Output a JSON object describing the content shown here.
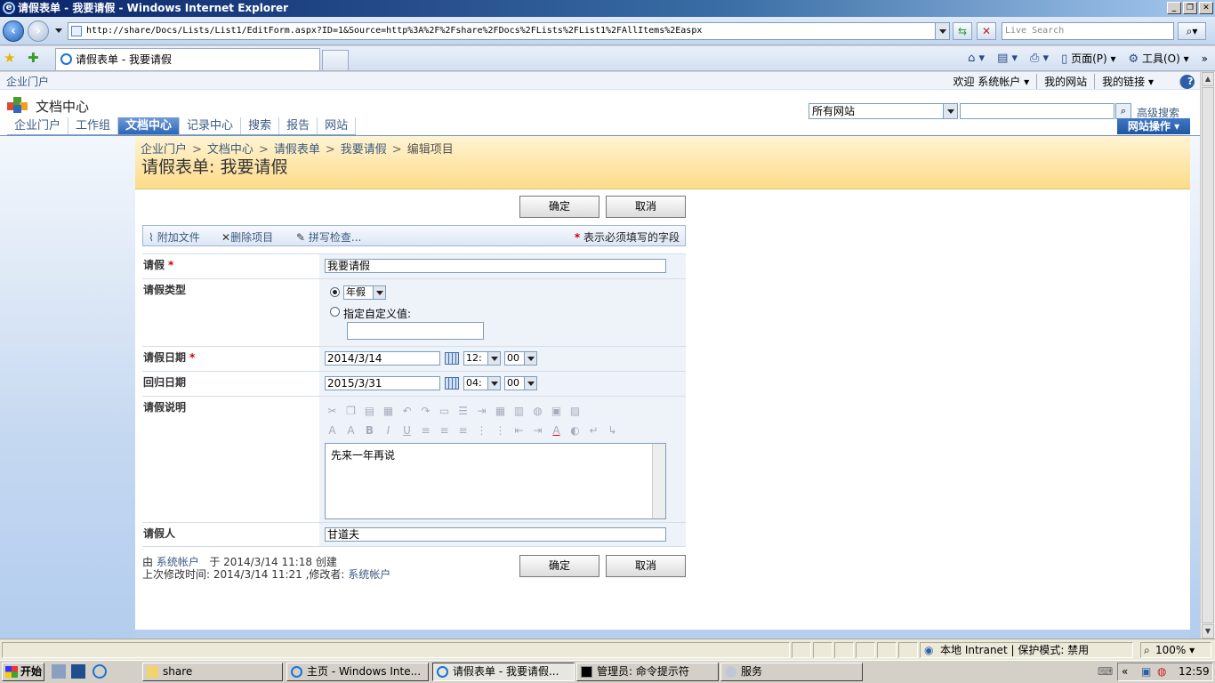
{
  "window": {
    "title": "请假表单 - 我要请假 - Windows Internet Explorer",
    "min": "_",
    "max": "❐",
    "close": "✕"
  },
  "address": {
    "url": "http://share/Docs/Lists/List1/EditForm.aspx?ID=1&Source=http%3A%2F%2Fshare%2FDocs%2FLists%2FList1%2FAllItems%2Easpx",
    "search_placeholder": "Live Search"
  },
  "tab": {
    "label": "请假表单 - 我要请假"
  },
  "commands": {
    "page": "页面(P)",
    "tools": "工具(O)"
  },
  "sharepoint": {
    "portal": "企业门户",
    "welcome": "欢迎 系统帐户 ▾",
    "my_site": "我的网站",
    "my_links": "我的链接 ▾",
    "site_title": "文档中心",
    "search_scope": "所有网站",
    "advanced_search": "高级搜索",
    "site_actions": "网站操作 ▾",
    "topnav": [
      {
        "label": "企业门户"
      },
      {
        "label": "工作组"
      },
      {
        "label": "文档中心"
      },
      {
        "label": "记录中心"
      },
      {
        "label": "搜索"
      },
      {
        "label": "报告"
      },
      {
        "label": "网站"
      }
    ],
    "breadcrumb": [
      "企业门户",
      "文档中心",
      "请假表单",
      "我要请假",
      "编辑项目"
    ],
    "breadcrumb_sep": ">",
    "page_title": "请假表单:  我要请假"
  },
  "form": {
    "ok": "确定",
    "cancel": "取消",
    "toolbar": {
      "attach": "附加文件",
      "delete": "删除项目",
      "spell": "拼写检查...",
      "required_star": "*",
      "required_note": " 表示必须填写的字段"
    },
    "fields": {
      "title_label": "请假",
      "title_value": "我要请假",
      "type_label": "请假类型",
      "type_selected": "年假",
      "type_custom": "指定自定义值:",
      "start_label": "请假日期",
      "start_date": "2014/3/14",
      "start_hour": "12:",
      "start_min": "00",
      "end_label": "回归日期",
      "end_date": "2015/3/31",
      "end_hour": "04:",
      "end_min": "00",
      "desc_label": "请假说明",
      "desc_value": "先来一年再说",
      "person_label": "请假人",
      "person_value": "甘道夫",
      "required_star": "*"
    },
    "meta": {
      "created_prefix": "由",
      "created_by": "系统帐户",
      "created_at": "于 2014/3/14 11:18  创建",
      "modified_prefix": "上次修改时间: 2014/3/14 11:21 ,修改者:",
      "modified_by": "系统帐户"
    }
  },
  "statusbar": {
    "zone": "本地 Intranet | 保护模式: 禁用",
    "zoom": "100%"
  },
  "taskbar": {
    "start": "开始",
    "tasks": [
      {
        "label": "share"
      },
      {
        "label": "主页 - Windows Inte..."
      },
      {
        "label": "请假表单 - 我要请假..."
      },
      {
        "label": "管理员: 命令提示符"
      },
      {
        "label": "服务"
      }
    ],
    "clock": "12:59"
  }
}
